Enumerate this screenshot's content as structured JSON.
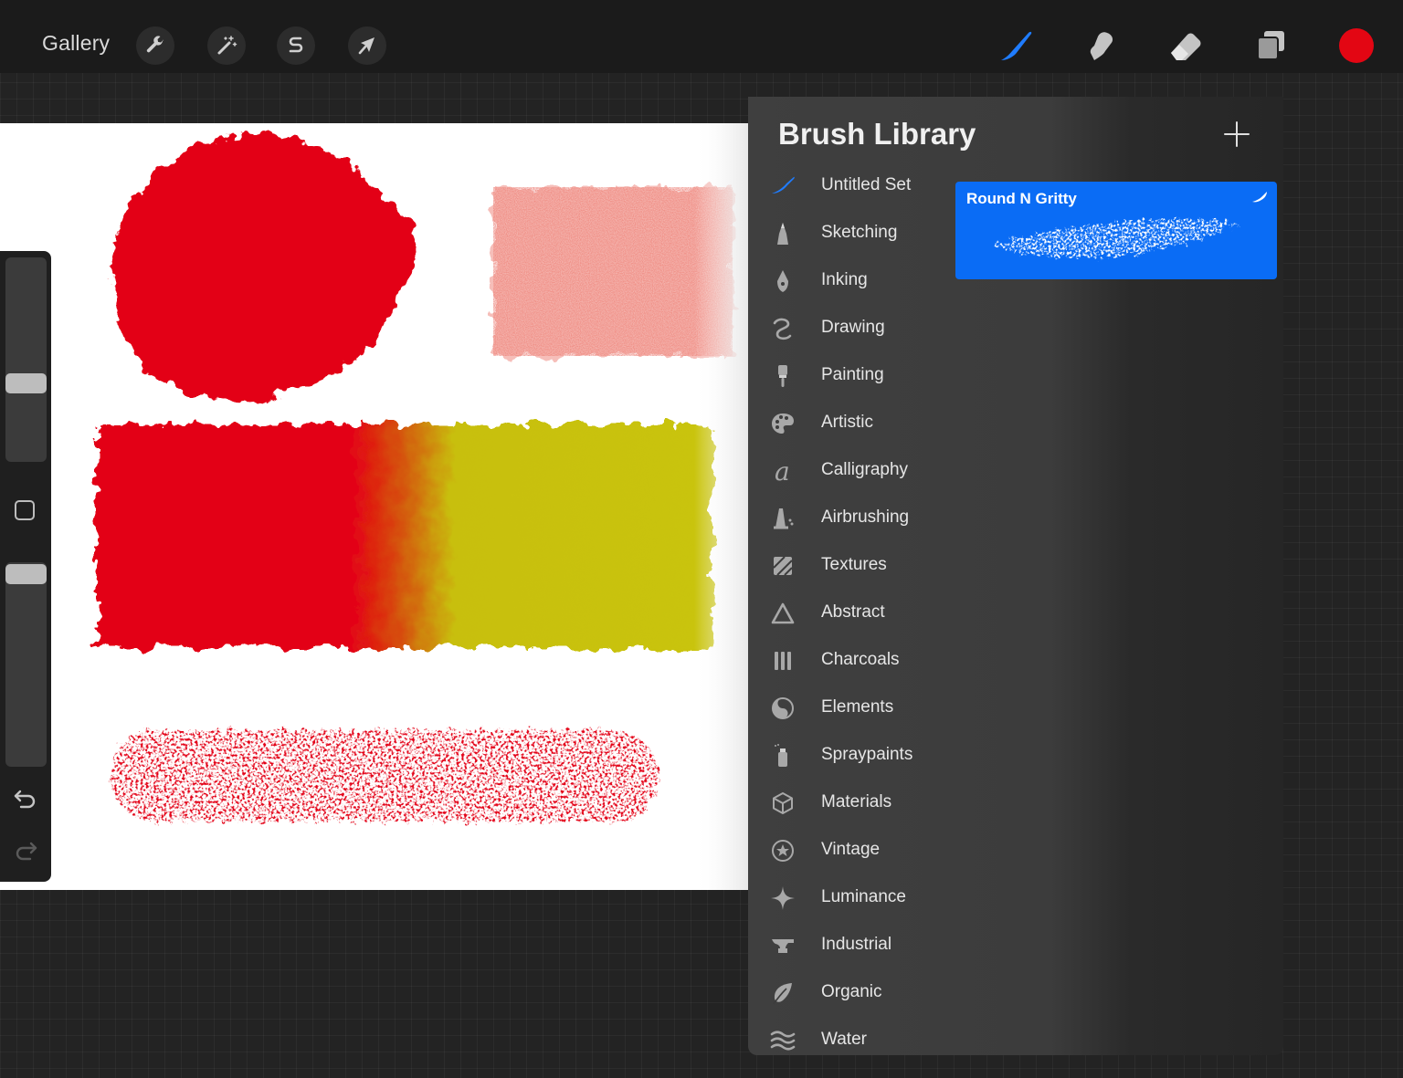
{
  "topbar": {
    "gallery_label": "Gallery",
    "left_tools": [
      "wrench-icon",
      "magic-wand-icon",
      "selection-s-icon",
      "transform-arrow-icon"
    ],
    "right_tools": [
      "brush-icon",
      "smudge-icon",
      "eraser-icon",
      "layers-icon"
    ],
    "active_tool": "brush-icon",
    "current_color": "#e30613"
  },
  "brush_library": {
    "title": "Brush Library",
    "sets": [
      {
        "label": "Untitled Set",
        "icon": "brush-stroke-icon",
        "selected": true
      },
      {
        "label": "Sketching",
        "icon": "pencil-tip-icon"
      },
      {
        "label": "Inking",
        "icon": "pen-nib-icon"
      },
      {
        "label": "Drawing",
        "icon": "squiggle-icon"
      },
      {
        "label": "Painting",
        "icon": "paintbrush-icon"
      },
      {
        "label": "Artistic",
        "icon": "palette-icon"
      },
      {
        "label": "Calligraphy",
        "icon": "calligraphy-a-icon"
      },
      {
        "label": "Airbrushing",
        "icon": "airbrush-icon"
      },
      {
        "label": "Textures",
        "icon": "texture-icon"
      },
      {
        "label": "Abstract",
        "icon": "triangle-icon"
      },
      {
        "label": "Charcoals",
        "icon": "charcoal-sticks-icon"
      },
      {
        "label": "Elements",
        "icon": "yin-yang-icon"
      },
      {
        "label": "Spraypaints",
        "icon": "spray-can-icon"
      },
      {
        "label": "Materials",
        "icon": "cube-icon"
      },
      {
        "label": "Vintage",
        "icon": "star-badge-icon"
      },
      {
        "label": "Luminance",
        "icon": "sparkle-icon"
      },
      {
        "label": "Industrial",
        "icon": "anvil-icon"
      },
      {
        "label": "Organic",
        "icon": "leaf-icon"
      },
      {
        "label": "Water",
        "icon": "waves-icon"
      }
    ],
    "selected_brush": {
      "name": "Round N Gritty",
      "accent": "#0a6cf5"
    }
  },
  "colors": {
    "red": "#e30613",
    "yellow": "#c8bf0a",
    "pink": "#f08a80"
  }
}
